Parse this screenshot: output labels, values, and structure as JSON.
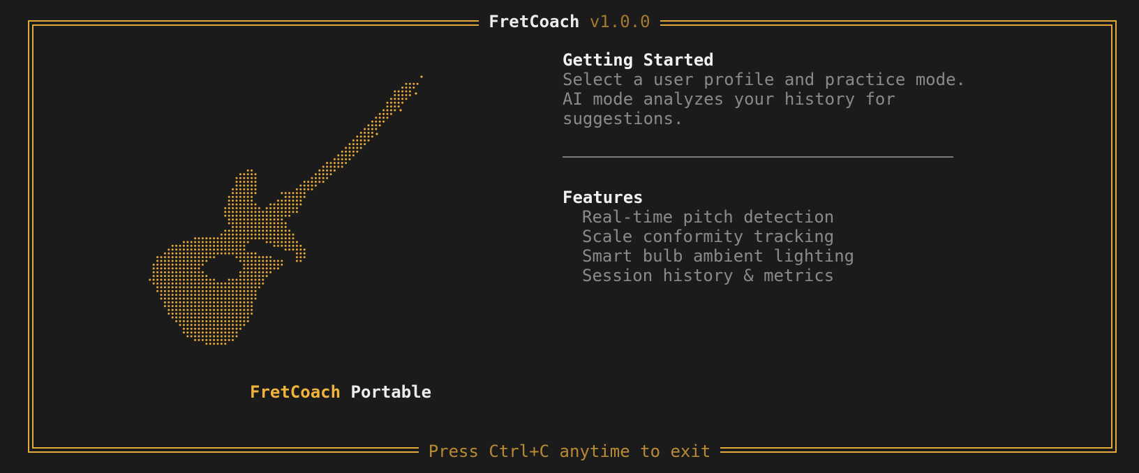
{
  "window": {
    "app_name": "FretCoach",
    "version": "v1.0.0",
    "footer_hint": "Press Ctrl+C anytime to exit"
  },
  "left_panel": {
    "logo": "guitar-ascii-art",
    "brand_primary": "FretCoach",
    "brand_secondary": "Portable"
  },
  "getting_started": {
    "heading": "Getting Started",
    "lines": [
      "Select a user profile and practice mode.",
      "AI mode analyzes your history for",
      "suggestions."
    ]
  },
  "features": {
    "heading": "Features",
    "items": [
      "Real-time pitch detection",
      "Scale conformity tracking",
      "Smart bulb ambient lighting",
      "Session history & metrics"
    ]
  },
  "colors": {
    "accent": "#e3a83a",
    "background": "#1b1b1b",
    "text_primary": "#f2f2f2",
    "text_muted": "#8a8a8a"
  }
}
